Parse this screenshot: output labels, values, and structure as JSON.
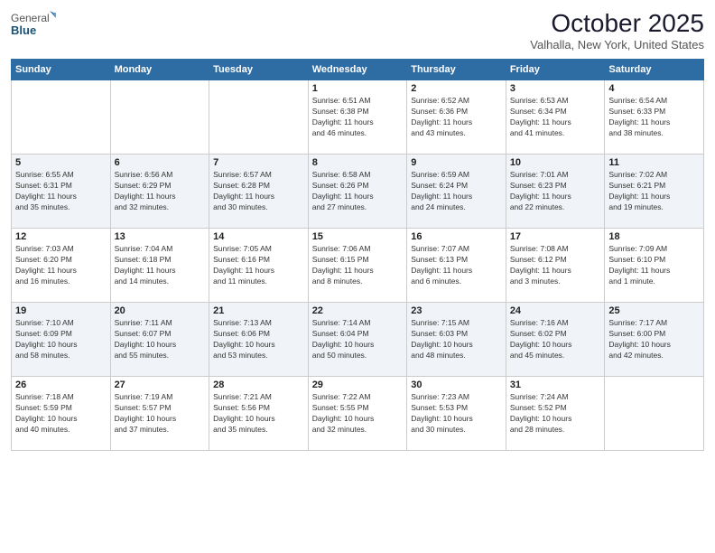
{
  "logo": {
    "general": "General",
    "blue": "Blue"
  },
  "title": "October 2025",
  "subtitle": "Valhalla, New York, United States",
  "headers": [
    "Sunday",
    "Monday",
    "Tuesday",
    "Wednesday",
    "Thursday",
    "Friday",
    "Saturday"
  ],
  "weeks": [
    [
      {
        "day": "",
        "info": ""
      },
      {
        "day": "",
        "info": ""
      },
      {
        "day": "",
        "info": ""
      },
      {
        "day": "1",
        "info": "Sunrise: 6:51 AM\nSunset: 6:38 PM\nDaylight: 11 hours\nand 46 minutes."
      },
      {
        "day": "2",
        "info": "Sunrise: 6:52 AM\nSunset: 6:36 PM\nDaylight: 11 hours\nand 43 minutes."
      },
      {
        "day": "3",
        "info": "Sunrise: 6:53 AM\nSunset: 6:34 PM\nDaylight: 11 hours\nand 41 minutes."
      },
      {
        "day": "4",
        "info": "Sunrise: 6:54 AM\nSunset: 6:33 PM\nDaylight: 11 hours\nand 38 minutes."
      }
    ],
    [
      {
        "day": "5",
        "info": "Sunrise: 6:55 AM\nSunset: 6:31 PM\nDaylight: 11 hours\nand 35 minutes."
      },
      {
        "day": "6",
        "info": "Sunrise: 6:56 AM\nSunset: 6:29 PM\nDaylight: 11 hours\nand 32 minutes."
      },
      {
        "day": "7",
        "info": "Sunrise: 6:57 AM\nSunset: 6:28 PM\nDaylight: 11 hours\nand 30 minutes."
      },
      {
        "day": "8",
        "info": "Sunrise: 6:58 AM\nSunset: 6:26 PM\nDaylight: 11 hours\nand 27 minutes."
      },
      {
        "day": "9",
        "info": "Sunrise: 6:59 AM\nSunset: 6:24 PM\nDaylight: 11 hours\nand 24 minutes."
      },
      {
        "day": "10",
        "info": "Sunrise: 7:01 AM\nSunset: 6:23 PM\nDaylight: 11 hours\nand 22 minutes."
      },
      {
        "day": "11",
        "info": "Sunrise: 7:02 AM\nSunset: 6:21 PM\nDaylight: 11 hours\nand 19 minutes."
      }
    ],
    [
      {
        "day": "12",
        "info": "Sunrise: 7:03 AM\nSunset: 6:20 PM\nDaylight: 11 hours\nand 16 minutes."
      },
      {
        "day": "13",
        "info": "Sunrise: 7:04 AM\nSunset: 6:18 PM\nDaylight: 11 hours\nand 14 minutes."
      },
      {
        "day": "14",
        "info": "Sunrise: 7:05 AM\nSunset: 6:16 PM\nDaylight: 11 hours\nand 11 minutes."
      },
      {
        "day": "15",
        "info": "Sunrise: 7:06 AM\nSunset: 6:15 PM\nDaylight: 11 hours\nand 8 minutes."
      },
      {
        "day": "16",
        "info": "Sunrise: 7:07 AM\nSunset: 6:13 PM\nDaylight: 11 hours\nand 6 minutes."
      },
      {
        "day": "17",
        "info": "Sunrise: 7:08 AM\nSunset: 6:12 PM\nDaylight: 11 hours\nand 3 minutes."
      },
      {
        "day": "18",
        "info": "Sunrise: 7:09 AM\nSunset: 6:10 PM\nDaylight: 11 hours\nand 1 minute."
      }
    ],
    [
      {
        "day": "19",
        "info": "Sunrise: 7:10 AM\nSunset: 6:09 PM\nDaylight: 10 hours\nand 58 minutes."
      },
      {
        "day": "20",
        "info": "Sunrise: 7:11 AM\nSunset: 6:07 PM\nDaylight: 10 hours\nand 55 minutes."
      },
      {
        "day": "21",
        "info": "Sunrise: 7:13 AM\nSunset: 6:06 PM\nDaylight: 10 hours\nand 53 minutes."
      },
      {
        "day": "22",
        "info": "Sunrise: 7:14 AM\nSunset: 6:04 PM\nDaylight: 10 hours\nand 50 minutes."
      },
      {
        "day": "23",
        "info": "Sunrise: 7:15 AM\nSunset: 6:03 PM\nDaylight: 10 hours\nand 48 minutes."
      },
      {
        "day": "24",
        "info": "Sunrise: 7:16 AM\nSunset: 6:02 PM\nDaylight: 10 hours\nand 45 minutes."
      },
      {
        "day": "25",
        "info": "Sunrise: 7:17 AM\nSunset: 6:00 PM\nDaylight: 10 hours\nand 42 minutes."
      }
    ],
    [
      {
        "day": "26",
        "info": "Sunrise: 7:18 AM\nSunset: 5:59 PM\nDaylight: 10 hours\nand 40 minutes."
      },
      {
        "day": "27",
        "info": "Sunrise: 7:19 AM\nSunset: 5:57 PM\nDaylight: 10 hours\nand 37 minutes."
      },
      {
        "day": "28",
        "info": "Sunrise: 7:21 AM\nSunset: 5:56 PM\nDaylight: 10 hours\nand 35 minutes."
      },
      {
        "day": "29",
        "info": "Sunrise: 7:22 AM\nSunset: 5:55 PM\nDaylight: 10 hours\nand 32 minutes."
      },
      {
        "day": "30",
        "info": "Sunrise: 7:23 AM\nSunset: 5:53 PM\nDaylight: 10 hours\nand 30 minutes."
      },
      {
        "day": "31",
        "info": "Sunrise: 7:24 AM\nSunset: 5:52 PM\nDaylight: 10 hours\nand 28 minutes."
      },
      {
        "day": "",
        "info": ""
      }
    ]
  ]
}
